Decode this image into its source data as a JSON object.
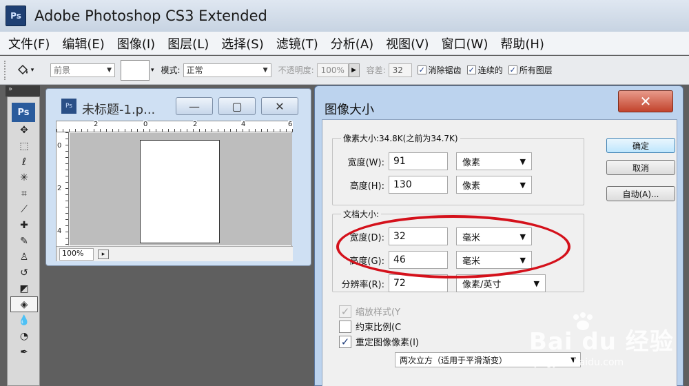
{
  "app": {
    "logo": "Ps",
    "title": "Adobe Photoshop CS3 Extended"
  },
  "menu": [
    "文件(F)",
    "编辑(E)",
    "图像(I)",
    "图层(L)",
    "选择(S)",
    "滤镜(T)",
    "分析(A)",
    "视图(V)",
    "窗口(W)",
    "帮助(H)"
  ],
  "options_bar": {
    "tool_icon": "paint-bucket-icon",
    "fill_source": "前景",
    "mode_label": "模式:",
    "mode_value": "正常",
    "opacity_label": "不透明度:",
    "opacity_value": "100%",
    "tolerance_label": "容差:",
    "tolerance_value": "32",
    "anti_alias_label": "消除锯齿",
    "contiguous_label": "连续的",
    "all_layers_label": "所有图层"
  },
  "toolbox": {
    "collapse": "»",
    "badge": "Ps",
    "tools": [
      "move-icon",
      "marquee-icon",
      "lasso-icon",
      "magic-wand-icon",
      "crop-icon",
      "slice-icon",
      "healing-icon",
      "brush-icon",
      "clone-stamp-icon",
      "history-brush-icon",
      "eraser-icon",
      "paint-bucket-icon",
      "blur-icon",
      "dodge-icon",
      "pen-icon"
    ]
  },
  "document": {
    "title": "未标题-1.p...",
    "minimize_glyph": "—",
    "maximize_glyph": "▢",
    "close_glyph": "✕",
    "zoom": "100%",
    "ruler_top_labels": [
      "2",
      "0",
      "2",
      "4",
      "6"
    ],
    "ruler_left_labels": [
      "0",
      "2",
      "4"
    ]
  },
  "dialog": {
    "title": "图像大小",
    "close_glyph": "✕",
    "pixel_dimensions_legend": "像素大小:34.8K(之前为34.7K)",
    "pixel_width_label": "宽度(W):",
    "pixel_width_value": "91",
    "pixel_width_unit": "像素",
    "pixel_height_label": "高度(H):",
    "pixel_height_value": "130",
    "pixel_height_unit": "像素",
    "document_size_legend": "文档大小:",
    "doc_width_label": "宽度(D):",
    "doc_width_value": "32",
    "doc_width_unit": "毫米",
    "doc_height_label": "高度(G):",
    "doc_height_value": "46",
    "doc_height_unit": "毫米",
    "resolution_label": "分辨率(R):",
    "resolution_value": "72",
    "resolution_unit": "像素/英寸",
    "ok_label": "确定",
    "cancel_label": "取消",
    "auto_label": "自动(A)...",
    "scale_styles_label": "缩放样式(Y",
    "constrain_label": "约束比例(C",
    "resample_label": "重定图像像素(I)",
    "resample_method": "两次立方（适用于平滑渐变）",
    "check_mark": "✓"
  },
  "watermark": {
    "brand": "Bai du 经验",
    "url": "jingyan.baidu.com"
  },
  "colors": {
    "highlight": "#d4111b",
    "dialog_frame": "#bcd3ee",
    "close_button": "#c2432c"
  }
}
